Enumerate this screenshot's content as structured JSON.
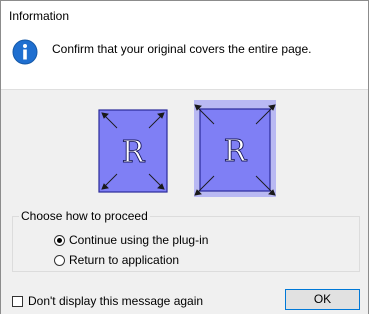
{
  "dialog": {
    "title": "Information",
    "message": "Confirm that your original covers the entire page.",
    "illustration_letter": "R"
  },
  "group": {
    "legend": "Choose how to proceed",
    "options": [
      {
        "label": "Continue using the plug-in",
        "selected": true
      },
      {
        "label": "Return to application",
        "selected": false
      }
    ]
  },
  "footer": {
    "checkbox_label": "Don't display this message again",
    "checkbox_checked": false,
    "ok_label": "OK"
  },
  "colors": {
    "page_fill": "#7f7ff5",
    "page_border": "#2a2a9a",
    "glow": "#b9b9f3",
    "info_icon": "#1f6fd0",
    "focus_border": "#0078d7"
  },
  "icons": [
    "info-icon",
    "document-illustration-icon",
    "document-covered-illustration-icon"
  ]
}
